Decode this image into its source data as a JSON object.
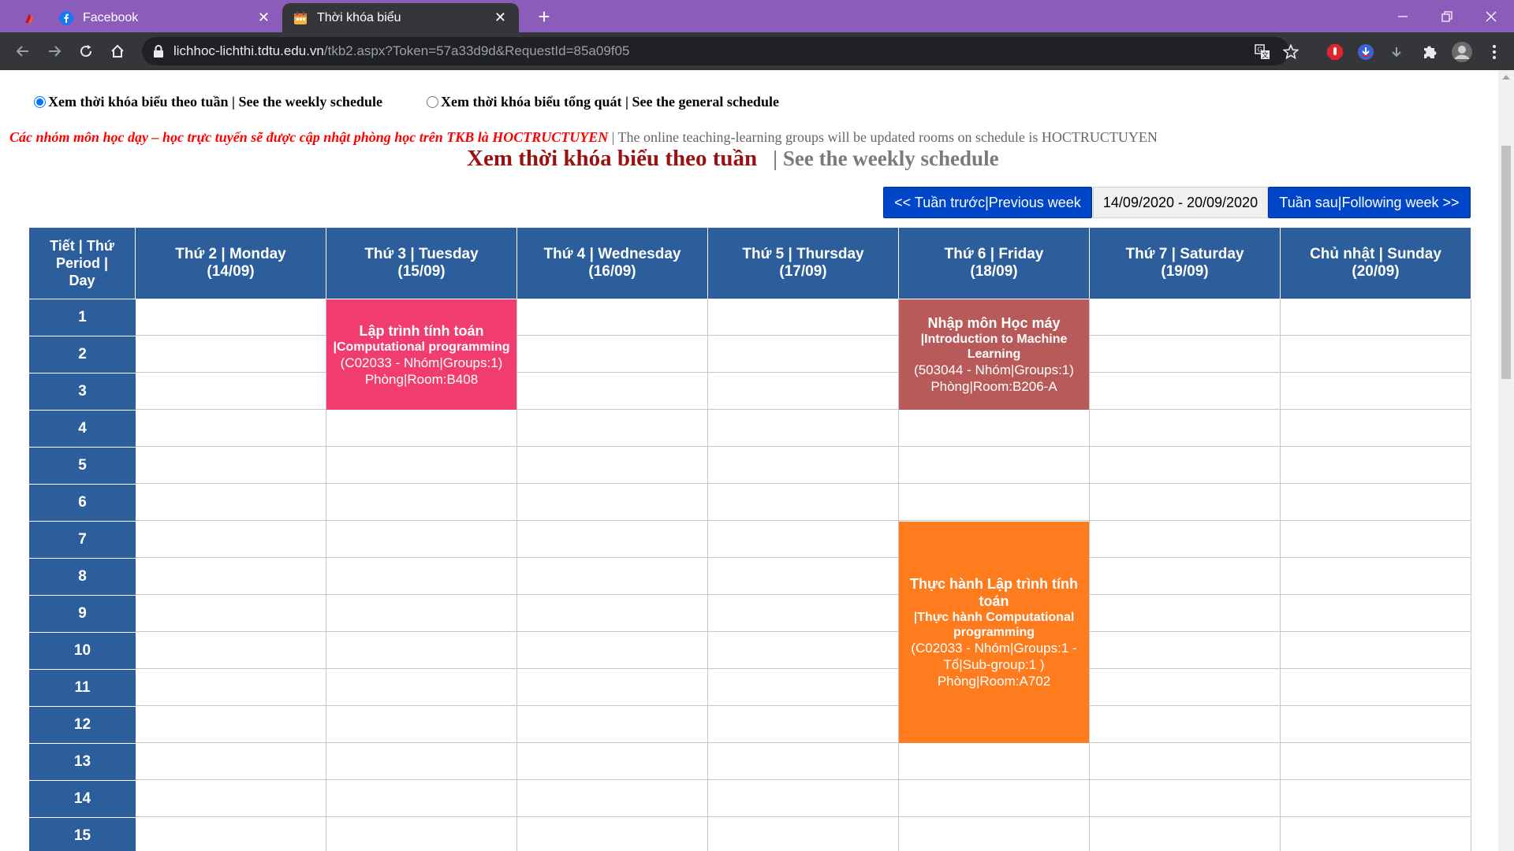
{
  "browser": {
    "tabs": [
      {
        "title": "Facebook"
      },
      {
        "title": "Thời khóa biểu"
      }
    ],
    "url_host": "lichhoc-lichthi.tdtu.edu.vn",
    "url_path": "/tkb2.aspx?Token=57a33d9d&RequestId=85a09f05"
  },
  "view_options": {
    "weekly_label": "Xem thời khóa biểu theo tuần | See the weekly schedule",
    "general_label": "Xem thời khóa biểu tổng quát | See the general schedule",
    "selected": "weekly"
  },
  "notice": {
    "vi": "Các nhóm môn học dạy – học trực tuyến sẽ được cập nhật phòng học trên TKB là HOCTRUCTUYEN",
    "en": "| The online teaching-learning groups will be updated rooms on schedule is HOCTRUCTUYEN"
  },
  "heading": {
    "vi": "Xem thời khóa biểu theo tuần",
    "en": "| See the weekly schedule"
  },
  "week_nav": {
    "prev_label": "<< Tuần trước|Previous week",
    "range": "14/09/2020 - 20/09/2020",
    "next_label": "Tuần sau|Following week >>"
  },
  "schedule": {
    "period_header": [
      "Tiết | Thứ",
      "Period |",
      "Day"
    ],
    "days": [
      {
        "name": "Thứ 2 | Monday",
        "date": "(14/09)"
      },
      {
        "name": "Thứ 3 | Tuesday",
        "date": "(15/09)"
      },
      {
        "name": "Thứ 4 | Wednesday",
        "date": "(16/09)"
      },
      {
        "name": "Thứ 5 | Thursday",
        "date": "(17/09)"
      },
      {
        "name": "Thứ 6 | Friday",
        "date": "(18/09)"
      },
      {
        "name": "Thứ 7 | Saturday",
        "date": "(19/09)"
      },
      {
        "name": "Chủ nhật | Sunday",
        "date": "(20/09)"
      }
    ],
    "periods": [
      "1",
      "2",
      "3",
      "4",
      "5",
      "6",
      "7",
      "8",
      "9",
      "10",
      "11",
      "12",
      "13",
      "14",
      "15"
    ],
    "courses": [
      {
        "day": 1,
        "start": 1,
        "span": 3,
        "color": "#f03c6e",
        "name": "Lập trình tính toán",
        "en": "|Computational programming",
        "code": "(C02033 - Nhóm|Groups:1)",
        "room": "Phòng|Room:B408"
      },
      {
        "day": 4,
        "start": 1,
        "span": 3,
        "color": "#b95a5a",
        "name": "Nhập môn Học máy",
        "en": "|Introduction to Machine Learning",
        "code": "(503044 - Nhóm|Groups:1)",
        "room": "Phòng|Room:B206-A"
      },
      {
        "day": 4,
        "start": 7,
        "span": 6,
        "color": "#ff7c1e",
        "name": "Thực hành Lập trình tính toán",
        "en": "|Thực hành Computational programming",
        "code": "(C02033 - Nhóm|Groups:1 - Tổ|Sub-group:1 )",
        "room": "Phòng|Room:A702"
      }
    ]
  },
  "colors": {
    "header_blue": "#2c5e9c",
    "tabbar_purple": "#8b5cba",
    "button_blue": "#0046c8"
  },
  "icons": [
    "facebook-icon",
    "calendar-icon",
    "lock-icon",
    "translate-icon",
    "star-icon",
    "puzzle-icon",
    "avatar-icon",
    "menu-icon"
  ]
}
